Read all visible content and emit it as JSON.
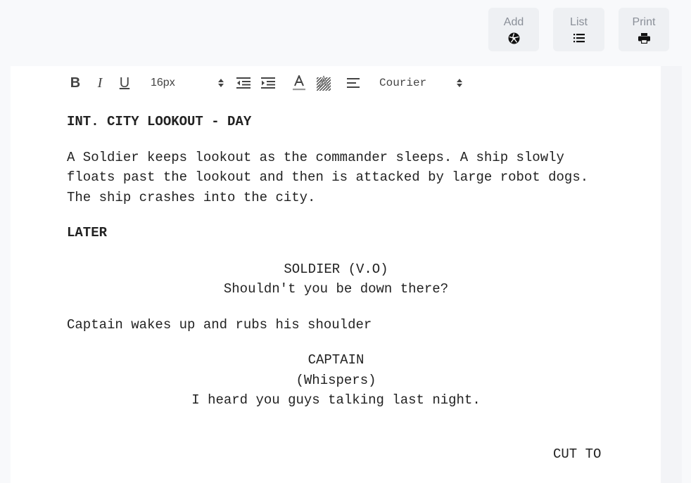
{
  "actions": {
    "add_label": "Add",
    "list_label": "List",
    "print_label": "Print"
  },
  "toolbar": {
    "bold": "B",
    "italic": "I",
    "underline": "U",
    "font_size": "16px",
    "font_family": "Courier"
  },
  "script": {
    "scene_heading": "INT. CITY LOOKOUT - DAY",
    "action_1": "A Soldier keeps lookout as the commander sleeps. A ship slowly floats past the lookout and then is attacked by large robot dogs. The ship crashes into the city.",
    "later": "LATER",
    "character_1": "SOLDIER (V.O)",
    "dialogue_1": "Shouldn't you be down there?",
    "action_2": "Captain wakes up and rubs his shoulder",
    "character_2": "CAPTAIN",
    "parenthetical_2": "(Whispers)",
    "dialogue_2": "I heard you guys talking last night.",
    "transition": "CUT TO"
  },
  "colors": {
    "background": "#f8f9fb",
    "editor": "#ffffff",
    "button_bg": "#eef0f3",
    "button_label": "#8a8f98",
    "text": "#222222"
  },
  "icons": {
    "add": "aperture-icon",
    "list": "list-icon",
    "print": "printer-icon"
  }
}
